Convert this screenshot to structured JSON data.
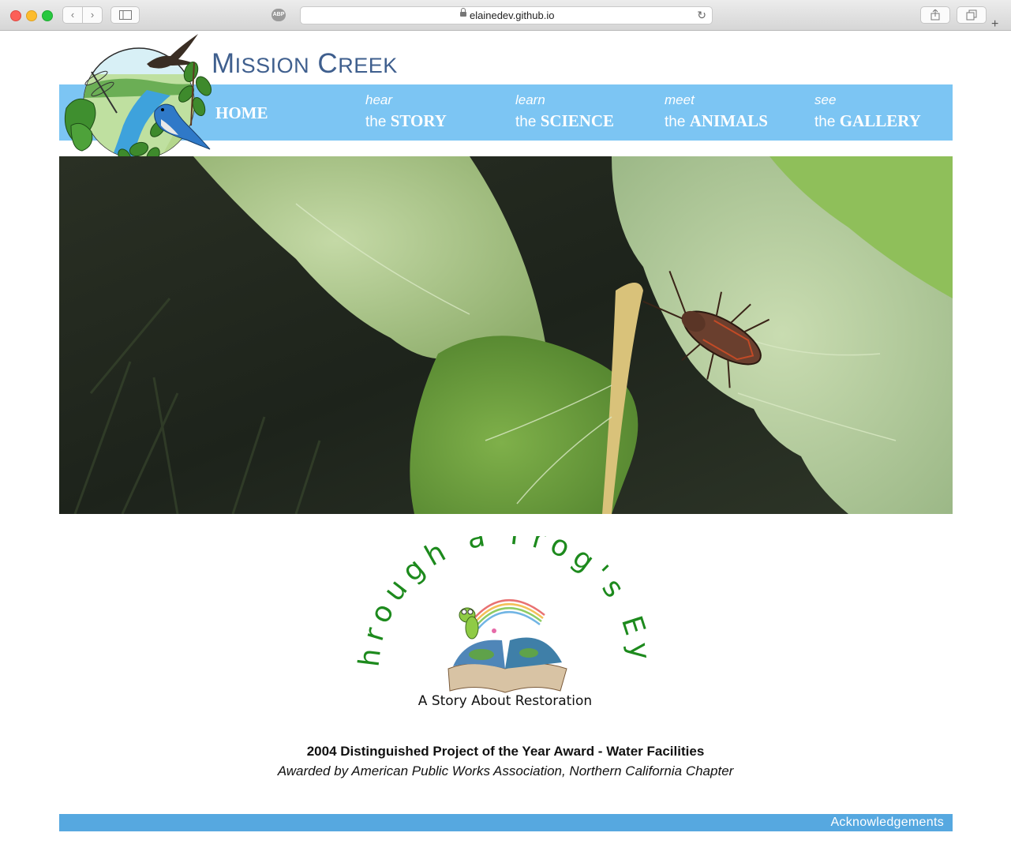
{
  "browser": {
    "url": "elainedev.github.io",
    "adblock_label": "ABP"
  },
  "site": {
    "title_part1_big": "M",
    "title_part1_small": "ISSION",
    "title_part2_big": "C",
    "title_part2_small": "REEK"
  },
  "nav": {
    "home": "HOME",
    "items": [
      {
        "pre": "hear",
        "the": "the",
        "main": "STORY"
      },
      {
        "pre": "learn",
        "the": "the",
        "main": "SCIENCE"
      },
      {
        "pre": "meet",
        "the": "the",
        "main": "ANIMALS"
      },
      {
        "pre": "see",
        "the": "the",
        "main": "GALLERY"
      }
    ]
  },
  "feature": {
    "arc_title": "Through a Frog's Eye",
    "subtitle": "A Story About Restoration"
  },
  "award": {
    "title": "2004 Distinguished Project of the Year Award - Water Facilities",
    "subtitle": "Awarded by American Public Works Association, Northern California Chapter"
  },
  "footer": {
    "link": "Acknowledgements"
  },
  "colors": {
    "nav_bg": "#7cc5f3",
    "footer_bg": "#56a8e0",
    "title": "#3f5f8e",
    "frog_green": "#1d8a1d"
  }
}
